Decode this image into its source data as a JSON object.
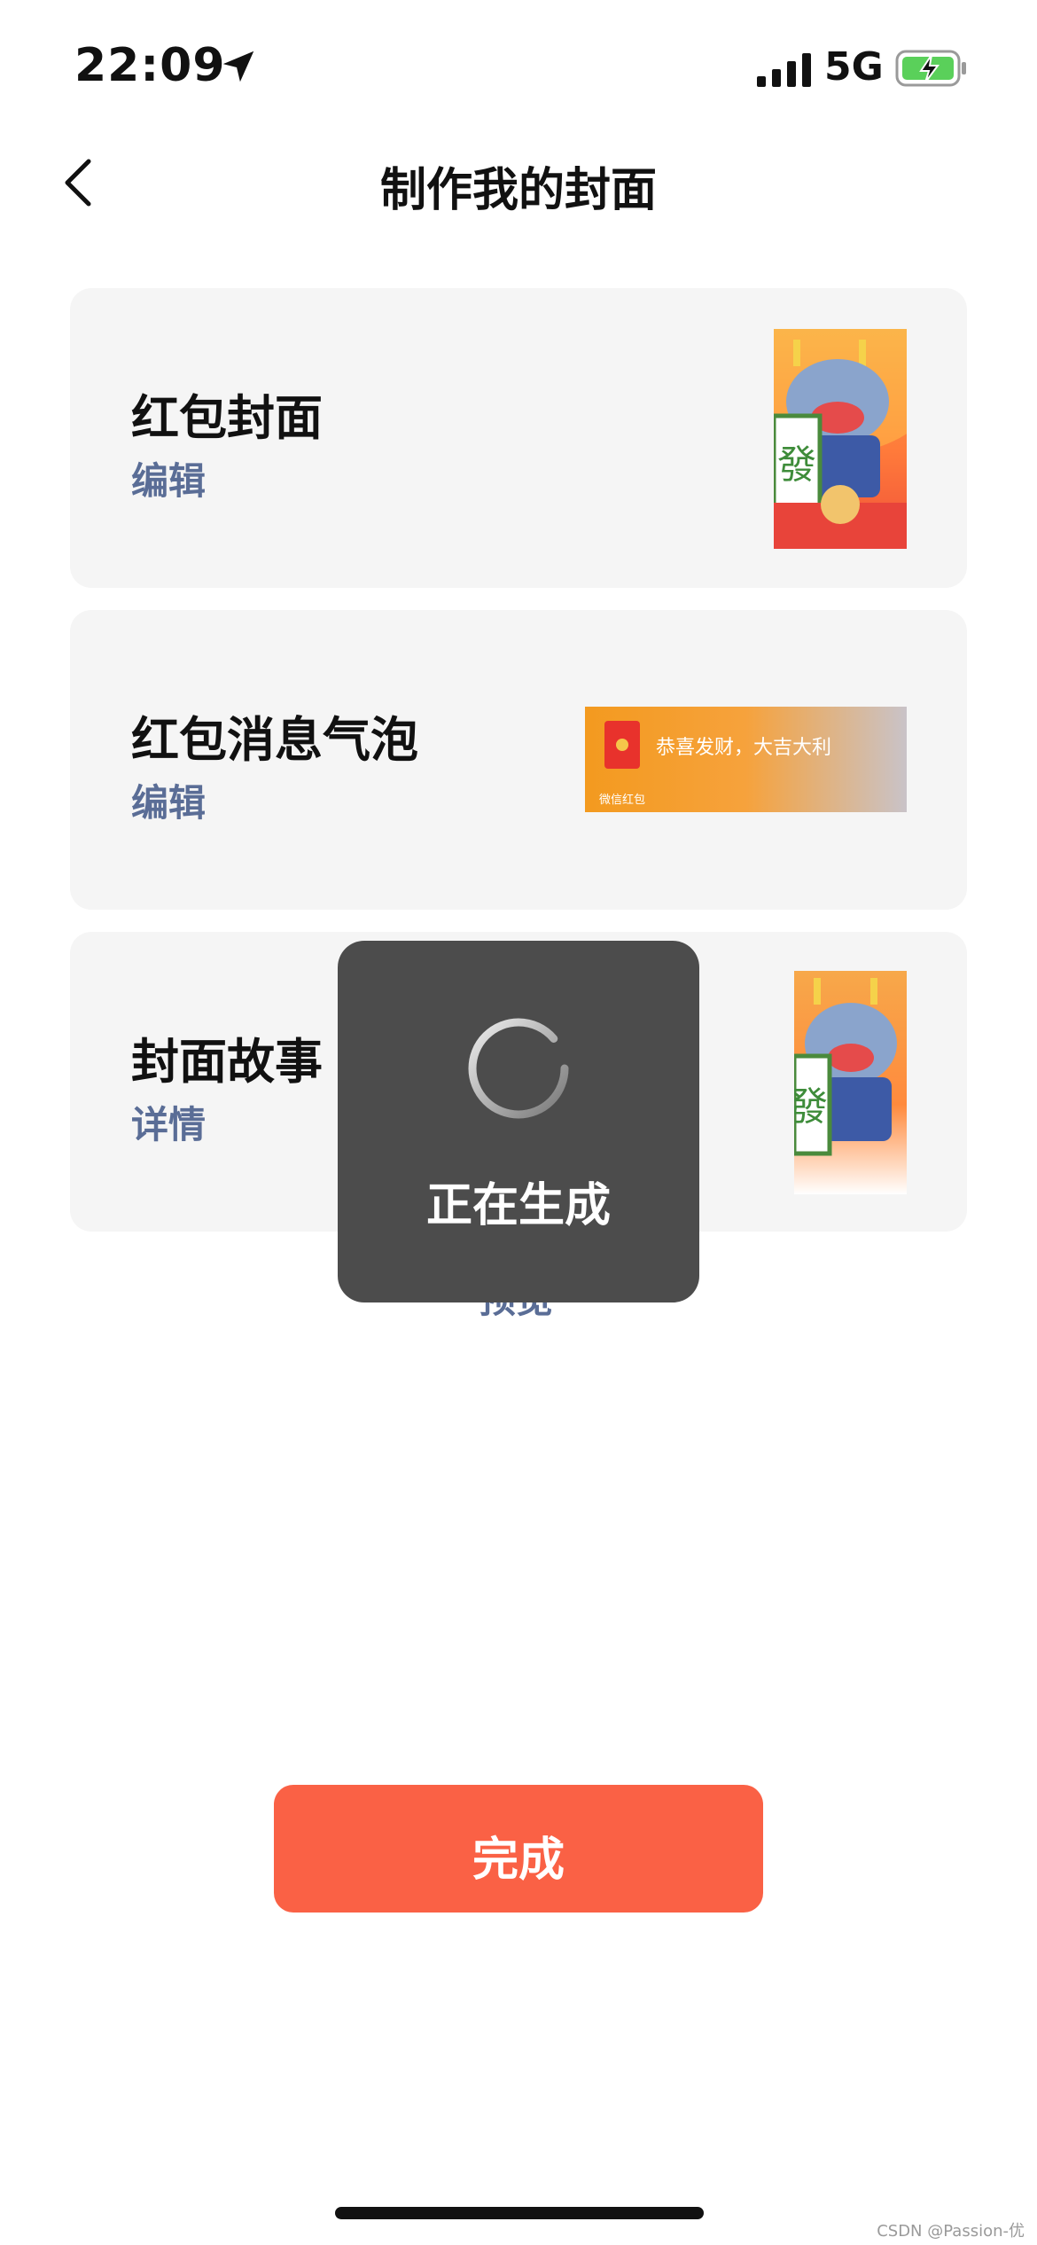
{
  "status_bar": {
    "time": "22:09",
    "network": "5G",
    "icons": [
      "location-arrow-icon",
      "signal-icon",
      "battery-charging-icon"
    ]
  },
  "nav": {
    "title": "制作我的封面",
    "back_icon": "chevron-left-icon"
  },
  "cards": [
    {
      "title": "红包封面",
      "link": "编辑"
    },
    {
      "title": "红包消息气泡",
      "link": "编辑",
      "bubble_text": "恭喜发财，大吉大利",
      "bubble_sub": "微信红包"
    },
    {
      "title": "封面故事",
      "link": "详情"
    }
  ],
  "hidden_link": "预览",
  "toast": {
    "label": "正在生成",
    "icon": "loading-spinner-icon"
  },
  "done_button": {
    "label": "完成"
  },
  "watermark": "CSDN @Passion-优",
  "colors": {
    "accent": "#fa6145",
    "link": "#5a6d96",
    "card_bg": "#f5f5f5",
    "toast_bg": "#4c4c4c",
    "battery_green": "#5ad05a"
  }
}
